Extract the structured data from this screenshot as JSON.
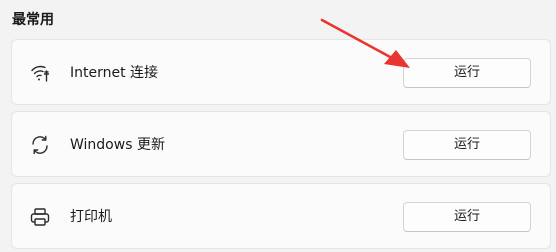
{
  "section": {
    "title": "最常用"
  },
  "items": [
    {
      "icon": "wifi-icon",
      "label": "Internet 连接",
      "button_label": "运行"
    },
    {
      "icon": "sync-icon",
      "label": "Windows 更新",
      "button_label": "运行"
    },
    {
      "icon": "printer-icon",
      "label": "打印机",
      "button_label": "运行"
    }
  ],
  "annotation": {
    "arrow_color": "#e8352f"
  }
}
